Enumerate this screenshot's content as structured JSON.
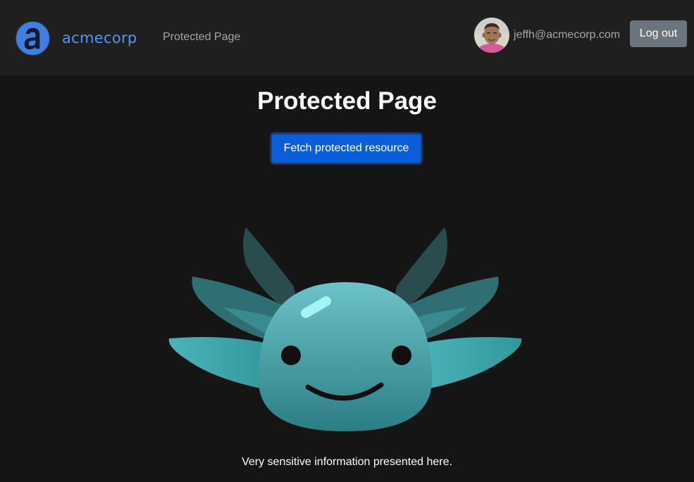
{
  "navbar": {
    "brand_name": "acmecorp",
    "brand_icon": "acmecorp-logo-icon",
    "link_protected": "Protected Page",
    "user_email": "jeffh@acmecorp.com",
    "logout_label": "Log out",
    "background": "#1f1f1f",
    "brand_color": "#5b93ec"
  },
  "main": {
    "title": "Protected Page",
    "fetch_button_label": "Fetch protected resource",
    "fetch_button_color": "#0b5ed7",
    "mascot_icon": "axolotl-mascot",
    "info_text": "Very sensitive information presented here."
  }
}
